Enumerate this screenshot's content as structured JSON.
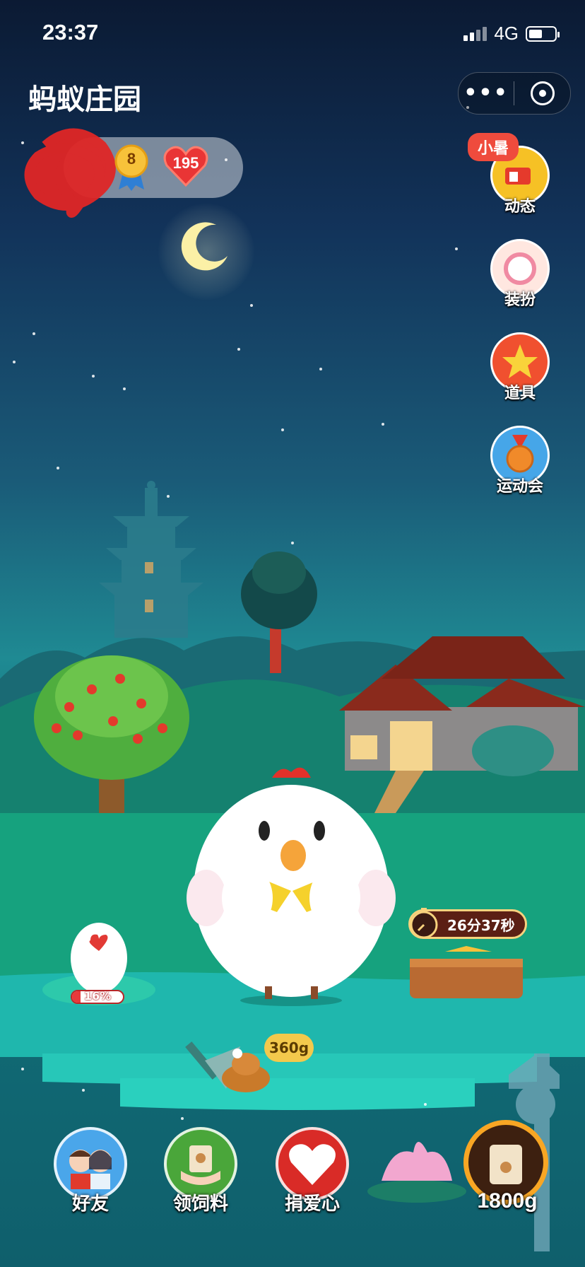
{
  "status_bar": {
    "time": "23:37",
    "network": "4G"
  },
  "header": {
    "title": "蚂蚁庄园",
    "more_label": "•••",
    "icons": [
      "more-icon",
      "close-mini-program-icon"
    ]
  },
  "profile": {
    "level": "8",
    "love_hearts": "195"
  },
  "side_menu": {
    "tag": "小暑",
    "items": [
      {
        "label": "动态",
        "icon": "mailbox-icon"
      },
      {
        "label": "装扮",
        "icon": "mirror-icon"
      },
      {
        "label": "道具",
        "icon": "star-icon"
      },
      {
        "label": "运动会",
        "icon": "medal-icon"
      }
    ]
  },
  "farm": {
    "feed_timer": "26分37秒",
    "egg_progress": "16%",
    "egg_progress_fraction": 0.16,
    "droppings_weight": "360g"
  },
  "bottom_bar": {
    "items": [
      {
        "label": "好友",
        "icon": "friends-icon"
      },
      {
        "label": "领饲料",
        "icon": "feed-bag-hand-icon"
      },
      {
        "label": "捐爱心",
        "icon": "heart-icon"
      }
    ],
    "food_amount": "1800g"
  },
  "colors": {
    "accent_red": "#ef4b3d",
    "feed_orange": "#f8a624",
    "sky_top": "#0b1a33",
    "water_teal": "#1fb7ad"
  }
}
